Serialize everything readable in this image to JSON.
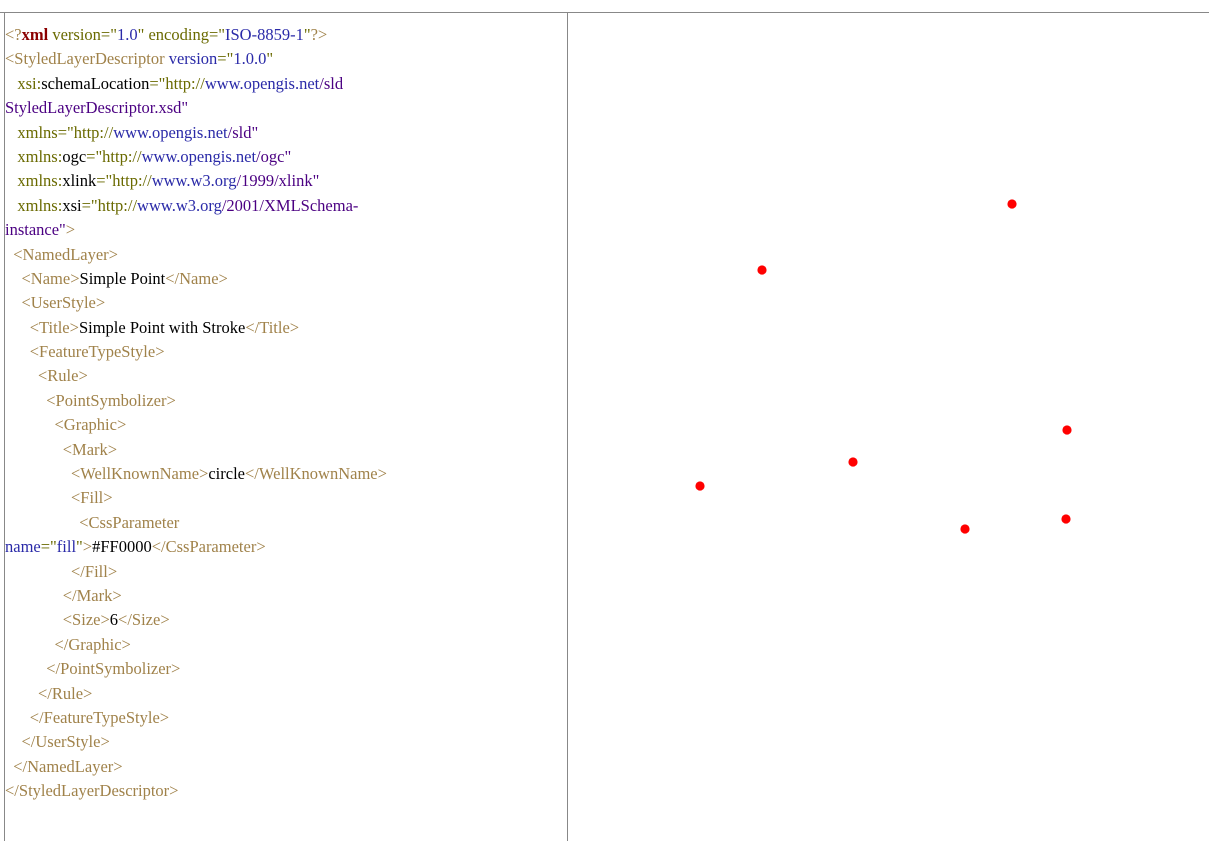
{
  "sld_xml": {
    "lines": [
      [
        {
          "c": "t",
          "s": "<?"
        },
        {
          "c": "k",
          "s": "xml"
        },
        {
          "c": "a",
          "s": " version=\""
        },
        {
          "c": "v",
          "s": "1.0"
        },
        {
          "c": "a",
          "s": "\" encoding=\""
        },
        {
          "c": "v",
          "s": "ISO-8859-1"
        },
        {
          "c": "a",
          "s": "\""
        },
        {
          "c": "t",
          "s": "?>"
        }
      ],
      [
        {
          "c": "t",
          "s": "<StyledLayerDescriptor "
        },
        {
          "c": "v",
          "s": "version"
        },
        {
          "c": "a",
          "s": "=\""
        },
        {
          "c": "v",
          "s": "1.0.0"
        },
        {
          "c": "a",
          "s": "\""
        }
      ],
      [
        {
          "c": "a",
          "s": "   xsi:"
        },
        {
          "c": "x",
          "s": "schemaLocation"
        },
        {
          "c": "a",
          "s": "=\"http://"
        },
        {
          "c": "v",
          "s": "www.opengis.net"
        },
        {
          "c": "vi",
          "s": "/sld"
        }
      ],
      [
        {
          "c": "vi",
          "s": "StyledLayerDescriptor.xsd\""
        }
      ],
      [
        {
          "c": "a",
          "s": "   xmlns=\"http://"
        },
        {
          "c": "v",
          "s": "www.opengis.net"
        },
        {
          "c": "vi",
          "s": "/sld\""
        }
      ],
      [
        {
          "c": "a",
          "s": "   xmlns:"
        },
        {
          "c": "x",
          "s": "ogc"
        },
        {
          "c": "a",
          "s": "=\"http://"
        },
        {
          "c": "v",
          "s": "www.opengis.net"
        },
        {
          "c": "vi",
          "s": "/ogc\""
        }
      ],
      [
        {
          "c": "a",
          "s": "   xmlns:"
        },
        {
          "c": "x",
          "s": "xlink"
        },
        {
          "c": "a",
          "s": "=\"http://"
        },
        {
          "c": "v",
          "s": "www.w3.org"
        },
        {
          "c": "vi",
          "s": "/1999/xlink\""
        }
      ],
      [
        {
          "c": "a",
          "s": "   xmlns:"
        },
        {
          "c": "x",
          "s": "xsi"
        },
        {
          "c": "a",
          "s": "=\"http://"
        },
        {
          "c": "v",
          "s": "www.w3.org"
        },
        {
          "c": "vi",
          "s": "/2001/XMLSchema-"
        }
      ],
      [
        {
          "c": "vi",
          "s": "instance\""
        },
        {
          "c": "t",
          "s": ">"
        }
      ],
      [
        {
          "c": "t",
          "s": "  <NamedLayer>"
        }
      ],
      [
        {
          "c": "t",
          "s": "    <Name>"
        },
        {
          "c": "x",
          "s": "Simple Point"
        },
        {
          "c": "t",
          "s": "</Name>"
        }
      ],
      [
        {
          "c": "t",
          "s": "    <UserStyle>"
        }
      ],
      [
        {
          "c": "t",
          "s": "      <Title>"
        },
        {
          "c": "x",
          "s": "Simple Point with Stroke"
        },
        {
          "c": "t",
          "s": "</Title>"
        }
      ],
      [
        {
          "c": "t",
          "s": "      <FeatureTypeStyle>"
        }
      ],
      [
        {
          "c": "t",
          "s": "        <Rule>"
        }
      ],
      [
        {
          "c": "t",
          "s": "          <PointSymbolizer>"
        }
      ],
      [
        {
          "c": "t",
          "s": "            <Graphic>"
        }
      ],
      [
        {
          "c": "t",
          "s": "              <Mark>"
        }
      ],
      [
        {
          "c": "t",
          "s": "                <WellKnownName>"
        },
        {
          "c": "x",
          "s": "circle"
        },
        {
          "c": "t",
          "s": "</WellKnownName>"
        }
      ],
      [
        {
          "c": "t",
          "s": "                <Fill>"
        }
      ],
      [
        {
          "c": "t",
          "s": "                  <CssParameter"
        }
      ],
      [
        {
          "c": "v",
          "s": "name"
        },
        {
          "c": "a",
          "s": "=\""
        },
        {
          "c": "v",
          "s": "fill"
        },
        {
          "c": "a",
          "s": "\""
        },
        {
          "c": "t",
          "s": ">"
        },
        {
          "c": "x",
          "s": "#FF0000"
        },
        {
          "c": "t",
          "s": "</CssParameter>"
        }
      ],
      [
        {
          "c": "t",
          "s": "                </Fill>"
        }
      ],
      [
        {
          "c": "t",
          "s": "              </Mark>"
        }
      ],
      [
        {
          "c": "t",
          "s": "              <Size>"
        },
        {
          "c": "x",
          "s": "6"
        },
        {
          "c": "t",
          "s": "</Size>"
        }
      ],
      [
        {
          "c": "t",
          "s": "            </Graphic>"
        }
      ],
      [
        {
          "c": "t",
          "s": "          </PointSymbolizer>"
        }
      ],
      [
        {
          "c": "t",
          "s": "        </Rule>"
        }
      ],
      [
        {
          "c": "t",
          "s": "      </FeatureTypeStyle>"
        }
      ],
      [
        {
          "c": "t",
          "s": "    </UserStyle>"
        }
      ],
      [
        {
          "c": "t",
          "s": "  </NamedLayer>"
        }
      ],
      [
        {
          "c": "t",
          "s": "</StyledLayerDescriptor>"
        }
      ]
    ]
  },
  "map_preview": {
    "point_color": "#ff0000",
    "point_count": 7
  }
}
